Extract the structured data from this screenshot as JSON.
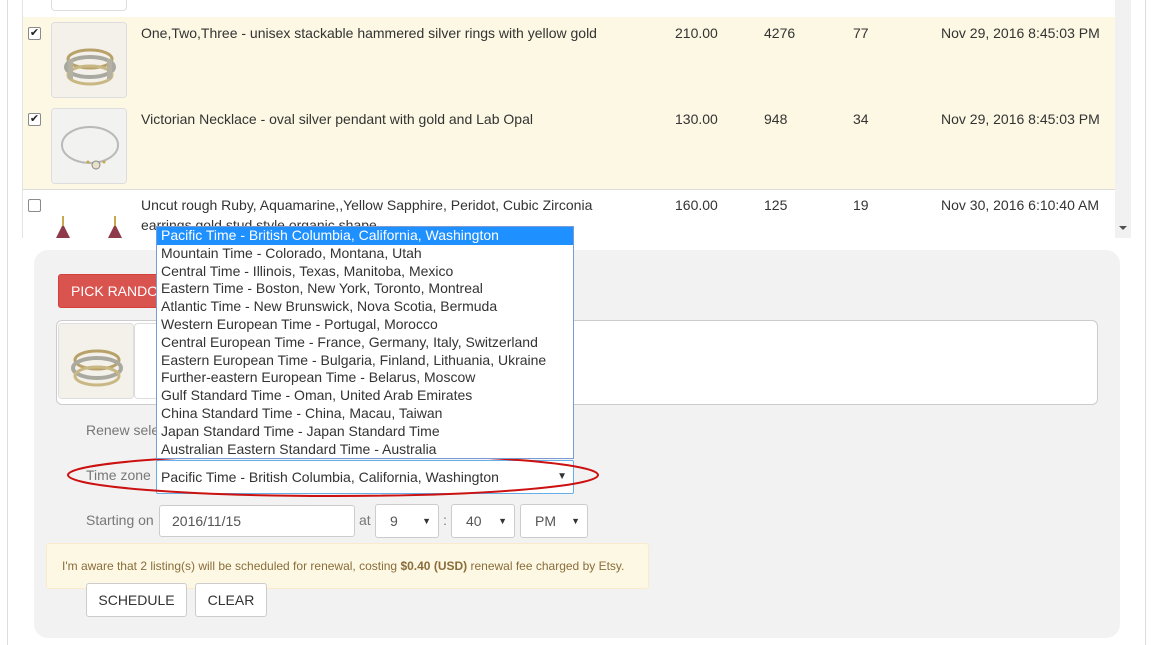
{
  "listings": [
    {
      "checked": true,
      "title": "One,Two,Three - unisex stackable hammered silver rings with yellow gold",
      "price": "210.00",
      "views": "4276",
      "favorites": "77",
      "date": "Nov 29, 2016 8:45:03 PM"
    },
    {
      "checked": true,
      "title": "Victorian Necklace - oval silver pendant with gold and Lab Opal",
      "price": "130.00",
      "views": "948",
      "favorites": "34",
      "date": "Nov 29, 2016 8:45:03 PM"
    },
    {
      "checked": false,
      "title": "Uncut rough Ruby, Aquamarine,,Yellow Sapphire, Peridot, Cubic Zirconia earrings gold stud style organic shape",
      "price": "160.00",
      "views": "125",
      "favorites": "19",
      "date": "Nov 30, 2016 6:10:40 AM"
    }
  ],
  "panel": {
    "pick_random_label": "PICK RANDOM",
    "renew_label": "Renew selected",
    "timezone_label": "Time zone",
    "timezone_selected": "Pacific Time - British Columbia, California, Washington",
    "timezone_options": [
      "Pacific Time - British Columbia, California, Washington",
      "Mountain Time - Colorado, Montana, Utah",
      "Central Time - Illinois, Texas, Manitoba, Mexico",
      "Eastern Time - Boston, New York, Toronto, Montreal",
      "Atlantic Time - New Brunswick, Nova Scotia, Bermuda",
      "Western European Time - Portugal, Morocco",
      "Central European Time - France, Germany, Italy, Switzerland",
      "Eastern European Time - Bulgaria, Finland, Lithuania, Ukraine",
      "Further-eastern European Time - Belarus, Moscow",
      "Gulf Standard Time - Oman, United Arab Emirates",
      "China Standard Time - China, Macau, Taiwan",
      "Japan Standard Time - Japan Standard Time",
      "Australian Eastern Standard Time - Australia"
    ],
    "starting_label": "Starting on",
    "date_value": "2016/11/15",
    "at_label": "at",
    "hour": "9",
    "colon": ":",
    "minute": "40",
    "ampm": "PM",
    "alert_prefix": "I'm aware that 2 listing(s) will be scheduled for renewal, costing ",
    "alert_amount": "$0.40 (USD)",
    "alert_suffix": " renewal fee charged by Etsy.",
    "schedule_label": "SCHEDULE",
    "clear_label": "CLEAR"
  },
  "colors": {
    "selected_row": "#fcf8e3",
    "danger_button": "#d9534f",
    "dropdown_highlight": "#1e90ff",
    "annotation": "#cc1111"
  }
}
